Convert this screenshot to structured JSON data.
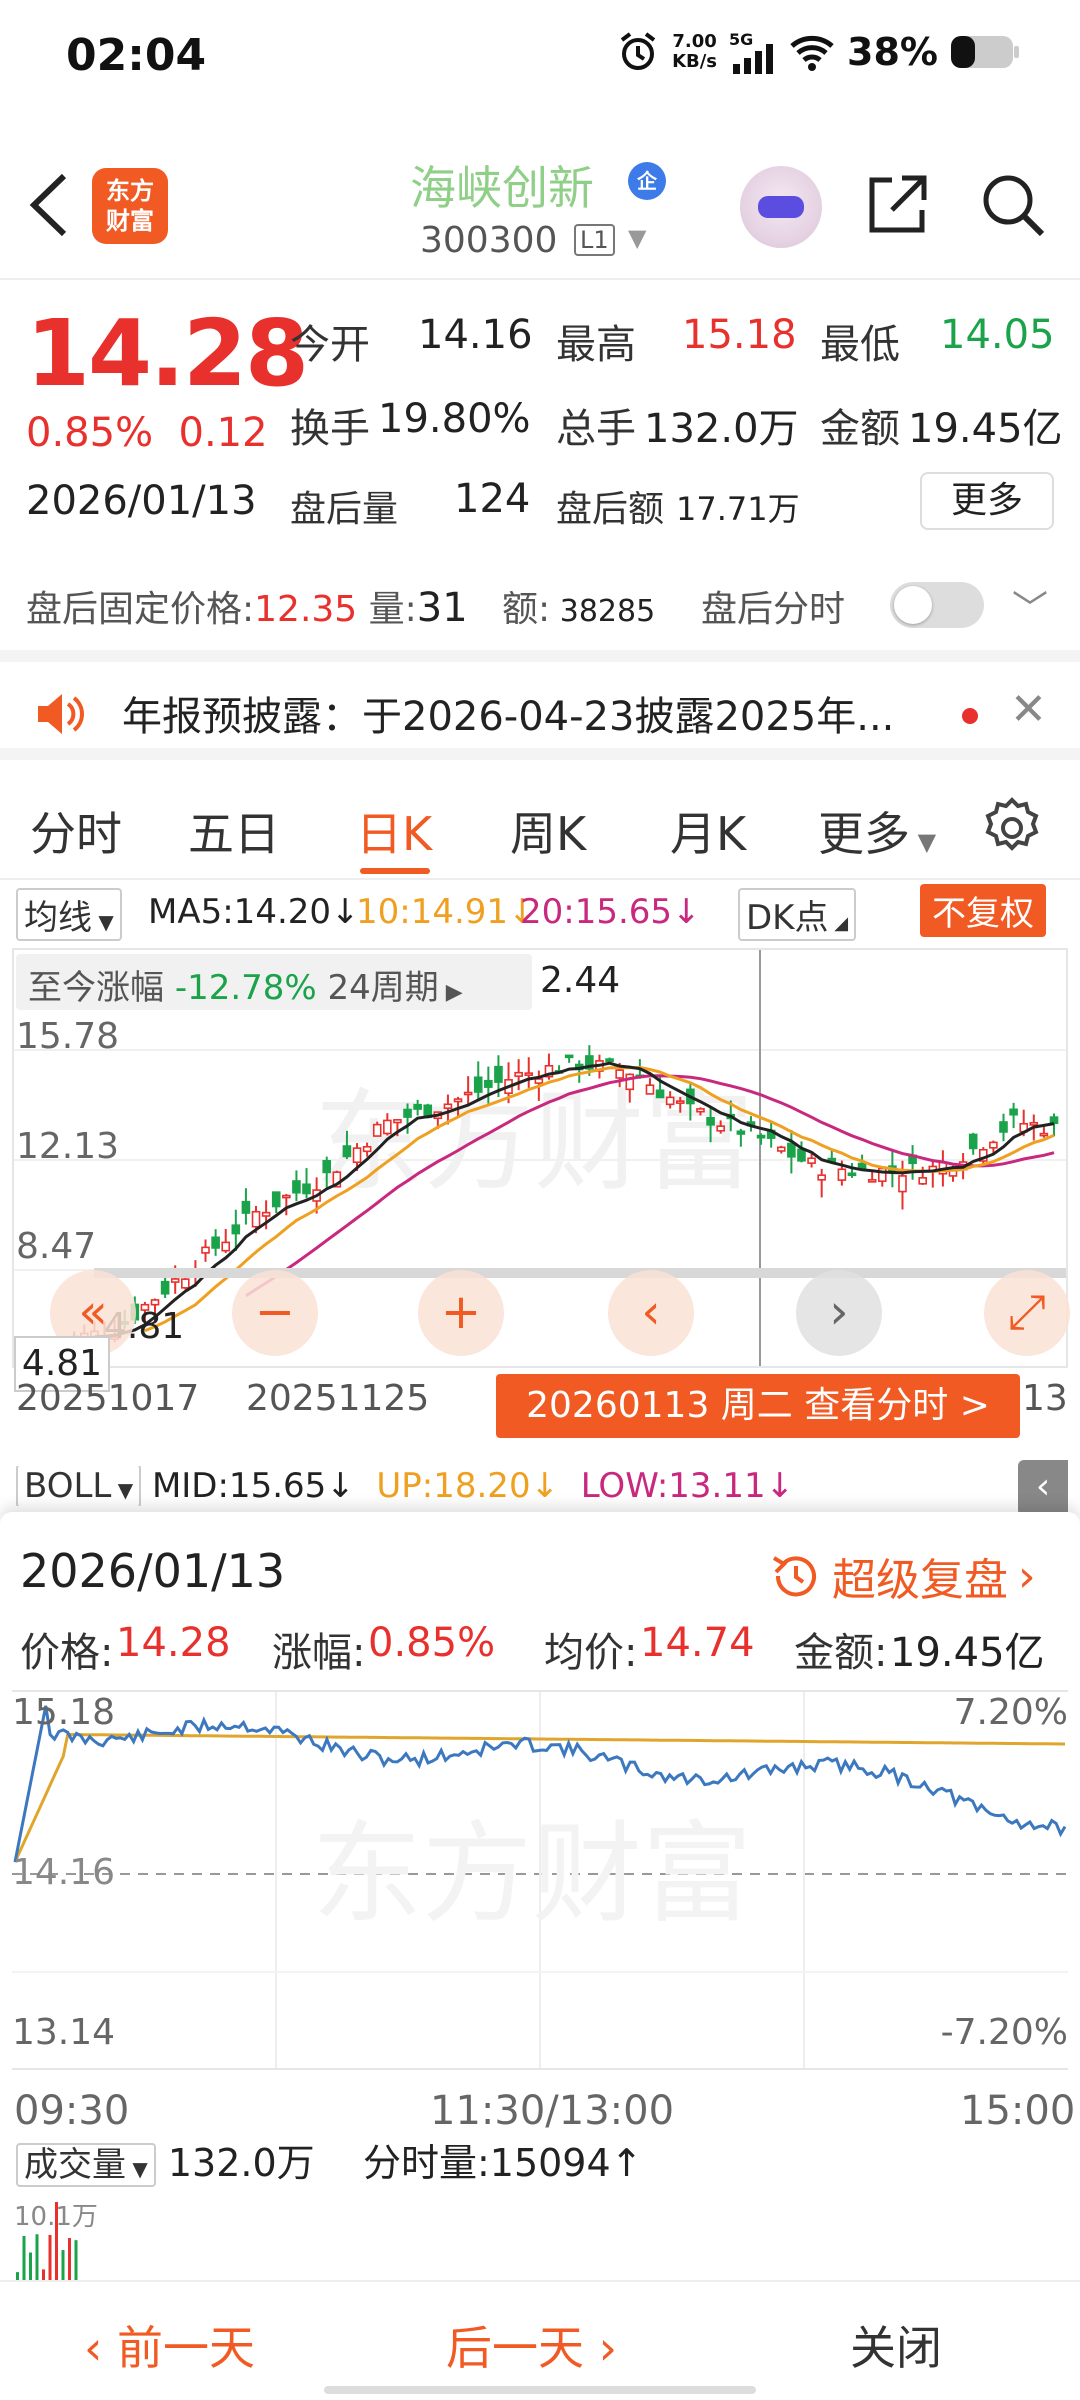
{
  "status_bar": {
    "time": "02:04",
    "net_speed": "7.00",
    "net_unit": "KB/s",
    "network": "5G",
    "battery": "38%"
  },
  "header": {
    "logo": "东方\n财富",
    "stock_name": "海峡创新",
    "badge": "企",
    "code": "300300",
    "level": "L1"
  },
  "quote": {
    "price": "14.28",
    "change_pct": "0.85%",
    "change_amt": "0.12",
    "date": "2026/01/13",
    "open_label": "今开",
    "open": "14.16",
    "high_label": "最高",
    "high": "15.18",
    "low_label": "最低",
    "low": "14.05",
    "turnover_label": "换手",
    "turnover": "19.80%",
    "volume_label": "总手",
    "volume": "132.0万",
    "amount_label": "金额",
    "amount": "19.45亿",
    "after_vol_label": "盘后量",
    "after_vol": "124",
    "after_amt_label": "盘后额",
    "after_amt": "17.71万",
    "more": "更多"
  },
  "after_hours": {
    "price_label": "盘后固定价格:",
    "price": "12.35",
    "vol_label": "量:",
    "vol": "31",
    "amt_label": "额:",
    "amt": "38285",
    "min_label": "盘后分时"
  },
  "notice": {
    "text": "年报预披露：于2026-04-23披露2025年..."
  },
  "tabs": [
    "分时",
    "五日",
    "日K",
    "周K",
    "月K",
    "更多"
  ],
  "kline": {
    "ma_select": "均线",
    "ma5": "MA5:14.20",
    "ma10": "10:14.91",
    "ma20": "20:15.65",
    "dk": "DK点",
    "fq": "不复权",
    "range_label": "至今涨幅",
    "range_pct": "-12.78%",
    "range_period": "24周期",
    "high_tag": "2.44",
    "y_labels": [
      "15.78",
      "12.13",
      "8.47"
    ],
    "low_tag": "4.81",
    "low_tag2": "4.81",
    "x_labels": [
      "20251017",
      "20251125"
    ],
    "x_last": "13",
    "date_banner": "20260113 周二 查看分时 >",
    "boll_select": "BOLL",
    "mid": "MID:15.65",
    "up": "UP:18.20",
    "low": "LOW:13.11",
    "colors": {
      "ma5": "#222222",
      "ma10": "#f0a020",
      "ma20": "#c8287e",
      "up": "#e8302d",
      "down": "#1aa34a"
    }
  },
  "minute": {
    "date": "2026/01/13",
    "replay": "超级复盘",
    "price_label": "价格:",
    "price": "14.28",
    "pct_label": "涨幅:",
    "pct": "0.85%",
    "avg_label": "均价:",
    "avg": "14.74",
    "amt_label": "金额:",
    "amt": "19.45亿",
    "y_top": "15.18",
    "y_mid": "14.16",
    "y_bot": "13.14",
    "pct_top": "7.20%",
    "pct_bot": "-7.20%",
    "t_start": "09:30",
    "t_mid": "11:30/13:00",
    "t_end": "15:00",
    "vol_select": "成交量",
    "vol_total": "132.0万",
    "min_vol_label": "分时量:",
    "min_vol": "15094",
    "vol_scale": "10.1万"
  },
  "bottom": {
    "prev": "前一天",
    "next": "后一天",
    "close": "关闭"
  }
}
